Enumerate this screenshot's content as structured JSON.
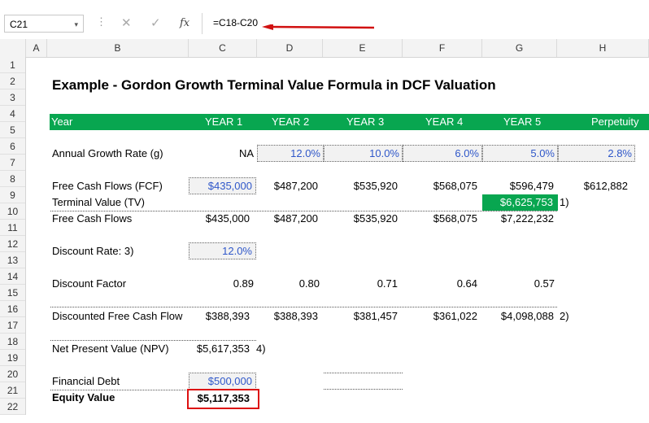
{
  "formula_bar": {
    "name_box": "C21",
    "dropdown": "▾",
    "dots": "⋮",
    "cancel": "✕",
    "enter": "✓",
    "fx": "fx",
    "formula": "=C18-C20"
  },
  "columns": [
    "A",
    "B",
    "C",
    "D",
    "E",
    "F",
    "G",
    "H"
  ],
  "rows": [
    "1",
    "2",
    "3",
    "4",
    "5",
    "6",
    "7",
    "8",
    "9",
    "10",
    "11",
    "12",
    "13",
    "14",
    "15",
    "16",
    "17",
    "18",
    "19",
    "20",
    "21",
    "22"
  ],
  "title": "Example - Gordon Growth Terminal Value Formula in DCF Valuation",
  "header": {
    "year": "Year",
    "y1": "YEAR 1",
    "y2": "YEAR 2",
    "y3": "YEAR 3",
    "y4": "YEAR 4",
    "y5": "YEAR 5",
    "perp": "Perpetuity"
  },
  "growth": {
    "label": "Annual Growth Rate (g)",
    "c": "NA",
    "d": "12.0%",
    "e": "10.0%",
    "f": "6.0%",
    "g": "5.0%",
    "h": "2.8%"
  },
  "fcf": {
    "label": "Free Cash Flows (FCF)",
    "c": "$435,000",
    "d": "$487,200",
    "e": "$535,920",
    "f": "$568,075",
    "g": "$596,479",
    "h": "$612,882"
  },
  "tv": {
    "label": "Terminal Value (TV)",
    "g": "$6,625,753",
    "note": "1)"
  },
  "fcf2": {
    "label": "Free Cash Flows",
    "c": "$435,000",
    "d": "$487,200",
    "e": "$535,920",
    "f": "$568,075",
    "g": "$7,222,232"
  },
  "discount_rate": {
    "label": "Discount Rate: 3)",
    "c": "12.0%"
  },
  "discount_factor": {
    "label": "Discount Factor",
    "c": "0.89",
    "d": "0.80",
    "e": "0.71",
    "f": "0.64",
    "g": "0.57"
  },
  "dfcf": {
    "label": "Discounted Free Cash Flow",
    "c": "$388,393",
    "d": "$388,393",
    "e": "$381,457",
    "f": "$361,022",
    "g": "$4,098,088",
    "note": "2)"
  },
  "npv": {
    "label": "Net Present Value (NPV)",
    "c": "$5,617,353",
    "note": "4)"
  },
  "debt": {
    "label": "Financial Debt",
    "c": "$500,000"
  },
  "equity": {
    "label": "Equity Value",
    "c": "$5,117,353"
  },
  "colors": {
    "green": "#08a650",
    "blue_input": "#2f57c9",
    "red_highlight": "#d11111"
  }
}
